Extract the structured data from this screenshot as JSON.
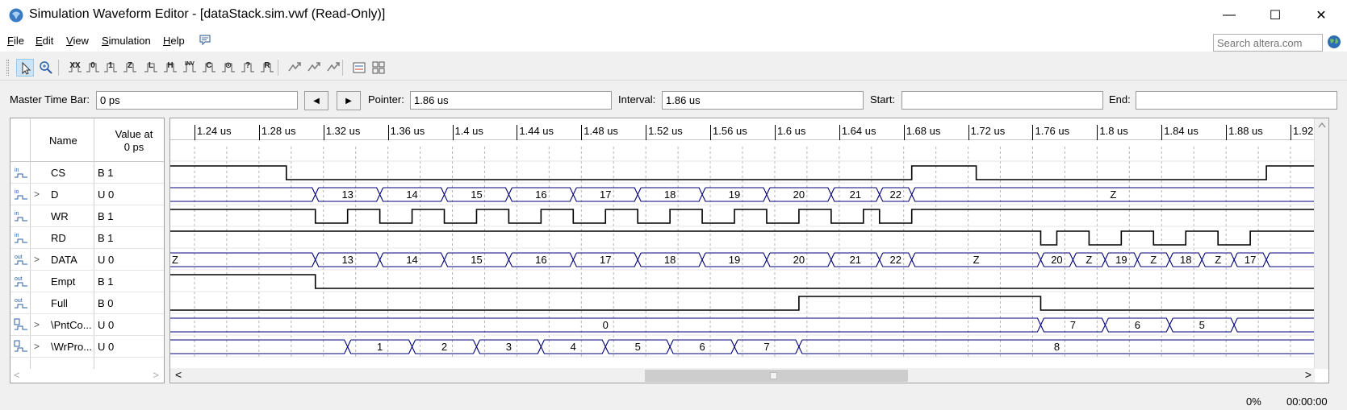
{
  "window": {
    "title": "Simulation Waveform Editor - [dataStack.sim.vwf (Read-Only)]",
    "controls": {
      "minimize": "—",
      "maximize": "☐",
      "close": "✕"
    }
  },
  "menu": {
    "items": [
      {
        "pre": "",
        "mnemonic": "F",
        "post": "ile"
      },
      {
        "pre": "",
        "mnemonic": "E",
        "post": "dit"
      },
      {
        "pre": "",
        "mnemonic": "V",
        "post": "iew"
      },
      {
        "pre": "",
        "mnemonic": "S",
        "post": "imulation"
      },
      {
        "pre": "",
        "mnemonic": "H",
        "post": "elp"
      }
    ],
    "search_placeholder": "Search altera.com"
  },
  "toolbar": {
    "buttons": [
      {
        "name": "select-tool",
        "icon": "pointer-icon",
        "glyph": ""
      },
      {
        "name": "zoom-tool",
        "icon": "zoom-icon",
        "glyph": ""
      },
      {
        "name": "forcing-unknown",
        "icon": "unknown-icon",
        "glyph": "XX"
      },
      {
        "name": "forcing-low",
        "icon": "low-icon",
        "glyph": "0"
      },
      {
        "name": "forcing-high",
        "icon": "high-icon",
        "glyph": "1"
      },
      {
        "name": "high-impedance",
        "icon": "hiz-icon",
        "glyph": "Z"
      },
      {
        "name": "weak-low",
        "icon": "weak-low-icon",
        "glyph": "L"
      },
      {
        "name": "weak-high",
        "icon": "weak-high-icon",
        "glyph": "H"
      },
      {
        "name": "invert",
        "icon": "invert-icon",
        "glyph": "INV"
      },
      {
        "name": "count-value",
        "icon": "count-icon",
        "glyph": "C"
      },
      {
        "name": "clock",
        "icon": "clock-icon",
        "glyph": "⊙"
      },
      {
        "name": "arbitrary-value",
        "icon": "arbitrary-icon",
        "glyph": "?"
      },
      {
        "name": "random-value",
        "icon": "random-icon",
        "glyph": "R"
      },
      {
        "name": "functional-sim",
        "icon": "functional-sim-icon",
        "glyph": ""
      },
      {
        "name": "timing-sim",
        "icon": "timing-sim-icon",
        "glyph": ""
      },
      {
        "name": "netlist-gen",
        "icon": "netlist-icon",
        "glyph": ""
      },
      {
        "name": "compare-window",
        "icon": "compare-icon",
        "glyph": ""
      },
      {
        "name": "group-nodes",
        "icon": "group-icon",
        "glyph": ""
      }
    ]
  },
  "timebar": {
    "master_label": "Master Time Bar:",
    "master_value": "0 ps",
    "prev": "◀",
    "next": "▶",
    "pointer_label": "Pointer:",
    "pointer_value": "1.86 us",
    "interval_label": "Interval:",
    "interval_value": "1.86 us",
    "start_label": "Start:",
    "start_value": "",
    "end_label": "End:",
    "end_value": ""
  },
  "signal_list": {
    "header_name": "Name",
    "header_value_line1": "Value at",
    "header_value_line2": "0 ps",
    "signals": [
      {
        "name": "CS",
        "value": "B 1",
        "dir": "in",
        "expandable": false
      },
      {
        "name": "D",
        "value": "U 0",
        "dir": "io",
        "expandable": true
      },
      {
        "name": "WR",
        "value": "B 1",
        "dir": "in",
        "expandable": false
      },
      {
        "name": "RD",
        "value": "B 1",
        "dir": "in",
        "expandable": false
      },
      {
        "name": "DATA",
        "value": "U 0",
        "dir": "out",
        "expandable": true
      },
      {
        "name": "Empt",
        "value": "B 1",
        "dir": "out",
        "expandable": false
      },
      {
        "name": "Full",
        "value": "B 0",
        "dir": "out",
        "expandable": false
      },
      {
        "name": "\\PntCo...",
        "value": "U 0",
        "dir": "bur",
        "expandable": true
      },
      {
        "name": "\\WrPro...",
        "value": "U 0",
        "dir": "bur",
        "expandable": true
      }
    ]
  },
  "waveform": {
    "time_start_us": 1.225,
    "time_end_us": 1.935,
    "ruler_labels": [
      "1.24 us",
      "1.28 us",
      "1.32 us",
      "1.36 us",
      "1.4 us",
      "1.44 us",
      "1.48 us",
      "1.52 us",
      "1.56 us",
      "1.6 us",
      "1.64 us",
      "1.68 us",
      "1.72 us",
      "1.76 us",
      "1.8 us",
      "1.84 us",
      "1.88 us",
      "1.92 us"
    ],
    "ruler_values_us": [
      1.24,
      1.28,
      1.32,
      1.36,
      1.4,
      1.44,
      1.48,
      1.52,
      1.56,
      1.6,
      1.64,
      1.68,
      1.72,
      1.76,
      1.8,
      1.84,
      1.88,
      1.92
    ],
    "colors": {
      "bit": "#000000",
      "bus": "#00007a",
      "grid": "#b4b4b4"
    },
    "traces": [
      {
        "signal": "CS",
        "kind": "bit",
        "segs": [
          [
            1.225,
            1.297,
            1
          ],
          [
            1.297,
            1.685,
            0
          ],
          [
            1.685,
            1.725,
            1
          ],
          [
            1.725,
            1.905,
            0
          ],
          [
            1.905,
            1.935,
            1
          ]
        ]
      },
      {
        "signal": "D",
        "kind": "bus",
        "segs": [
          [
            1.225,
            1.315,
            ""
          ],
          [
            1.315,
            1.355,
            "13"
          ],
          [
            1.355,
            1.395,
            "14"
          ],
          [
            1.395,
            1.435,
            "15"
          ],
          [
            1.435,
            1.475,
            "16"
          ],
          [
            1.475,
            1.515,
            "17"
          ],
          [
            1.515,
            1.555,
            "18"
          ],
          [
            1.555,
            1.595,
            "19"
          ],
          [
            1.595,
            1.635,
            "20"
          ],
          [
            1.635,
            1.665,
            "21"
          ],
          [
            1.665,
            1.685,
            "22"
          ],
          [
            1.685,
            1.935,
            "Z"
          ]
        ]
      },
      {
        "signal": "WR",
        "kind": "bit",
        "segs": [
          [
            1.225,
            1.315,
            1
          ],
          [
            1.315,
            1.335,
            0
          ],
          [
            1.335,
            1.355,
            1
          ],
          [
            1.355,
            1.375,
            0
          ],
          [
            1.375,
            1.395,
            1
          ],
          [
            1.395,
            1.415,
            0
          ],
          [
            1.415,
            1.435,
            1
          ],
          [
            1.435,
            1.455,
            0
          ],
          [
            1.455,
            1.475,
            1
          ],
          [
            1.475,
            1.495,
            0
          ],
          [
            1.495,
            1.515,
            1
          ],
          [
            1.515,
            1.535,
            0
          ],
          [
            1.535,
            1.555,
            1
          ],
          [
            1.555,
            1.575,
            0
          ],
          [
            1.575,
            1.595,
            1
          ],
          [
            1.595,
            1.615,
            0
          ],
          [
            1.615,
            1.635,
            1
          ],
          [
            1.635,
            1.655,
            0
          ],
          [
            1.655,
            1.665,
            1
          ],
          [
            1.665,
            1.685,
            0
          ],
          [
            1.685,
            1.935,
            1
          ]
        ]
      },
      {
        "signal": "RD",
        "kind": "bit",
        "segs": [
          [
            1.225,
            1.765,
            1
          ],
          [
            1.765,
            1.775,
            0
          ],
          [
            1.775,
            1.795,
            1
          ],
          [
            1.795,
            1.815,
            0
          ],
          [
            1.815,
            1.835,
            1
          ],
          [
            1.835,
            1.855,
            0
          ],
          [
            1.855,
            1.875,
            1
          ],
          [
            1.875,
            1.895,
            0
          ],
          [
            1.895,
            1.935,
            1
          ]
        ]
      },
      {
        "signal": "DATA",
        "kind": "bus",
        "segs": [
          [
            1.225,
            1.315,
            "Z"
          ],
          [
            1.315,
            1.355,
            "13"
          ],
          [
            1.355,
            1.395,
            "14"
          ],
          [
            1.395,
            1.435,
            "15"
          ],
          [
            1.435,
            1.475,
            "16"
          ],
          [
            1.475,
            1.515,
            "17"
          ],
          [
            1.515,
            1.555,
            "18"
          ],
          [
            1.555,
            1.595,
            "19"
          ],
          [
            1.595,
            1.635,
            "20"
          ],
          [
            1.635,
            1.665,
            "21"
          ],
          [
            1.665,
            1.685,
            "22"
          ],
          [
            1.685,
            1.765,
            "Z"
          ],
          [
            1.765,
            1.785,
            "20"
          ],
          [
            1.785,
            1.805,
            "Z"
          ],
          [
            1.805,
            1.825,
            "19"
          ],
          [
            1.825,
            1.845,
            "Z"
          ],
          [
            1.845,
            1.865,
            "18"
          ],
          [
            1.865,
            1.885,
            "Z"
          ],
          [
            1.885,
            1.905,
            "17"
          ],
          [
            1.905,
            1.935,
            ""
          ]
        ]
      },
      {
        "signal": "Empt",
        "kind": "bit",
        "segs": [
          [
            1.225,
            1.315,
            1
          ],
          [
            1.315,
            1.935,
            0
          ]
        ]
      },
      {
        "signal": "Full",
        "kind": "bit",
        "segs": [
          [
            1.225,
            1.615,
            0
          ],
          [
            1.615,
            1.765,
            1
          ],
          [
            1.765,
            1.935,
            0
          ]
        ]
      },
      {
        "signal": "PntCo",
        "kind": "bus",
        "segs": [
          [
            1.225,
            1.765,
            "0"
          ],
          [
            1.765,
            1.805,
            "7"
          ],
          [
            1.805,
            1.845,
            "6"
          ],
          [
            1.845,
            1.885,
            "5"
          ],
          [
            1.885,
            1.935,
            ""
          ]
        ]
      },
      {
        "signal": "WrPro",
        "kind": "bus",
        "segs": [
          [
            1.225,
            1.335,
            ""
          ],
          [
            1.335,
            1.375,
            "1"
          ],
          [
            1.375,
            1.415,
            "2"
          ],
          [
            1.415,
            1.455,
            "3"
          ],
          [
            1.455,
            1.495,
            "4"
          ],
          [
            1.495,
            1.535,
            "5"
          ],
          [
            1.535,
            1.575,
            "6"
          ],
          [
            1.575,
            1.615,
            "7"
          ],
          [
            1.615,
            1.935,
            "8"
          ]
        ]
      }
    ]
  },
  "scroll": {
    "left_arrow": "<",
    "right_arrow": ">",
    "small_left": "<",
    "small_right": ">"
  },
  "statusbar": {
    "progress": "0%",
    "elapsed": "00:00:00"
  }
}
